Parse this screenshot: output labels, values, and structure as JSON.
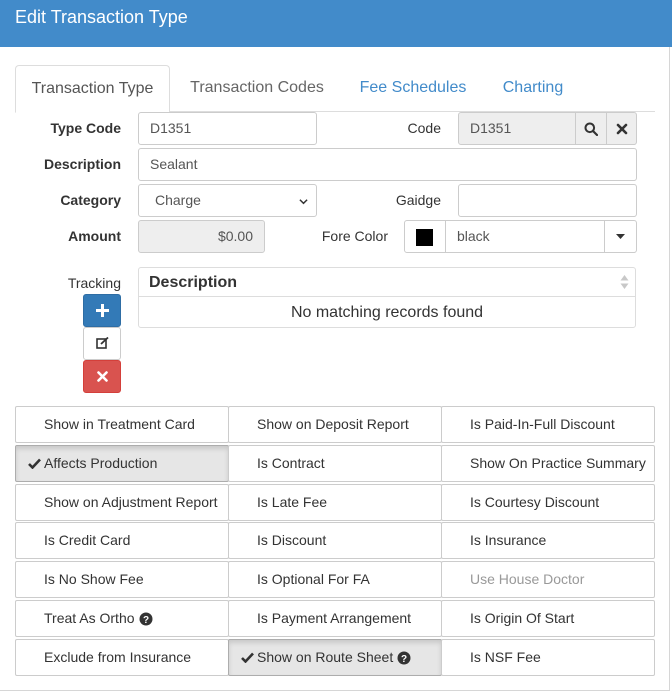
{
  "dialog": {
    "title": "Edit Transaction Type"
  },
  "tabs": [
    {
      "label": "Transaction Type",
      "active": true
    },
    {
      "label": "Transaction Codes",
      "active": false
    },
    {
      "label": "Fee Schedules",
      "active": false
    },
    {
      "label": "Charting",
      "active": false
    }
  ],
  "form": {
    "type_code": {
      "label": "Type Code",
      "value": "D1351"
    },
    "code": {
      "label": "Code",
      "value": "D1351"
    },
    "description": {
      "label": "Description",
      "value": "Sealant"
    },
    "category": {
      "label": "Category",
      "value": "Charge"
    },
    "gaidge": {
      "label": "Gaidge",
      "value": ""
    },
    "amount": {
      "label": "Amount",
      "value": "$0.00"
    },
    "fore_color": {
      "label": "Fore Color",
      "value": "black",
      "swatch": "#000000"
    }
  },
  "tracking": {
    "label": "Tracking",
    "column": "Description",
    "empty_text": "No matching records found",
    "colors": {
      "add": "#337ab7",
      "delete": "#d9534f"
    }
  },
  "toggles": [
    {
      "label": "Show in Treatment Card",
      "active": false,
      "disabled": false
    },
    {
      "label": "Show on Deposit Report",
      "active": false,
      "disabled": false
    },
    {
      "label": "Is Paid-In-Full Discount",
      "active": false,
      "disabled": false
    },
    {
      "label": "Affects Production",
      "active": true,
      "disabled": false
    },
    {
      "label": "Is Contract",
      "active": false,
      "disabled": false
    },
    {
      "label": "Show On Practice Summary",
      "active": false,
      "disabled": false
    },
    {
      "label": "Show on Adjustment Report",
      "active": false,
      "disabled": false
    },
    {
      "label": "Is Late Fee",
      "active": false,
      "disabled": false
    },
    {
      "label": "Is Courtesy Discount",
      "active": false,
      "disabled": false
    },
    {
      "label": "Is Credit Card",
      "active": false,
      "disabled": false
    },
    {
      "label": "Is Discount",
      "active": false,
      "disabled": false
    },
    {
      "label": "Is Insurance",
      "active": false,
      "disabled": false
    },
    {
      "label": "Is No Show Fee",
      "active": false,
      "disabled": false
    },
    {
      "label": "Is Optional For FA",
      "active": false,
      "disabled": false
    },
    {
      "label": "Use House Doctor",
      "active": false,
      "disabled": true
    },
    {
      "label": "Treat As Ortho",
      "active": false,
      "disabled": false,
      "help": true
    },
    {
      "label": "Is Payment Arrangement",
      "active": false,
      "disabled": false
    },
    {
      "label": "Is Origin Of Start",
      "active": false,
      "disabled": false
    },
    {
      "label": "Exclude from Insurance",
      "active": false,
      "disabled": false
    },
    {
      "label": "Show on Route Sheet",
      "active": true,
      "disabled": false,
      "help": true
    },
    {
      "label": "Is NSF Fee",
      "active": false,
      "disabled": false
    }
  ]
}
